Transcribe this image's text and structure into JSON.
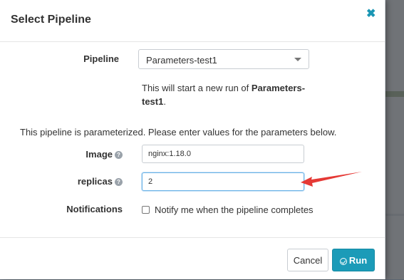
{
  "modal": {
    "title": "Select Pipeline",
    "close_icon": "close-icon"
  },
  "form": {
    "pipeline_label": "Pipeline",
    "pipeline_selected": "Parameters-test1",
    "run_info_prefix": "This will start a new run of ",
    "run_info_name_1": "Parameters-",
    "run_info_name_2": "test1",
    "run_info_suffix": ".",
    "parameterized_text": "This pipeline is parameterized. Please enter values for the parameters below.",
    "params": [
      {
        "label": "Image",
        "value": "nginx:1.18.0",
        "help_icon": "question-circle-icon"
      },
      {
        "label": "replicas",
        "value": "2",
        "help_icon": "question-circle-icon"
      }
    ],
    "notifications_label": "Notifications",
    "notify_checkbox_label": "Notify me when the pipeline completes",
    "notify_checked": false
  },
  "footer": {
    "cancel_label": "Cancel",
    "run_label": "Run",
    "run_icon": "check-circle-icon"
  },
  "colors": {
    "accent": "#1b9bb8",
    "annotation_arrow": "#e53935"
  }
}
